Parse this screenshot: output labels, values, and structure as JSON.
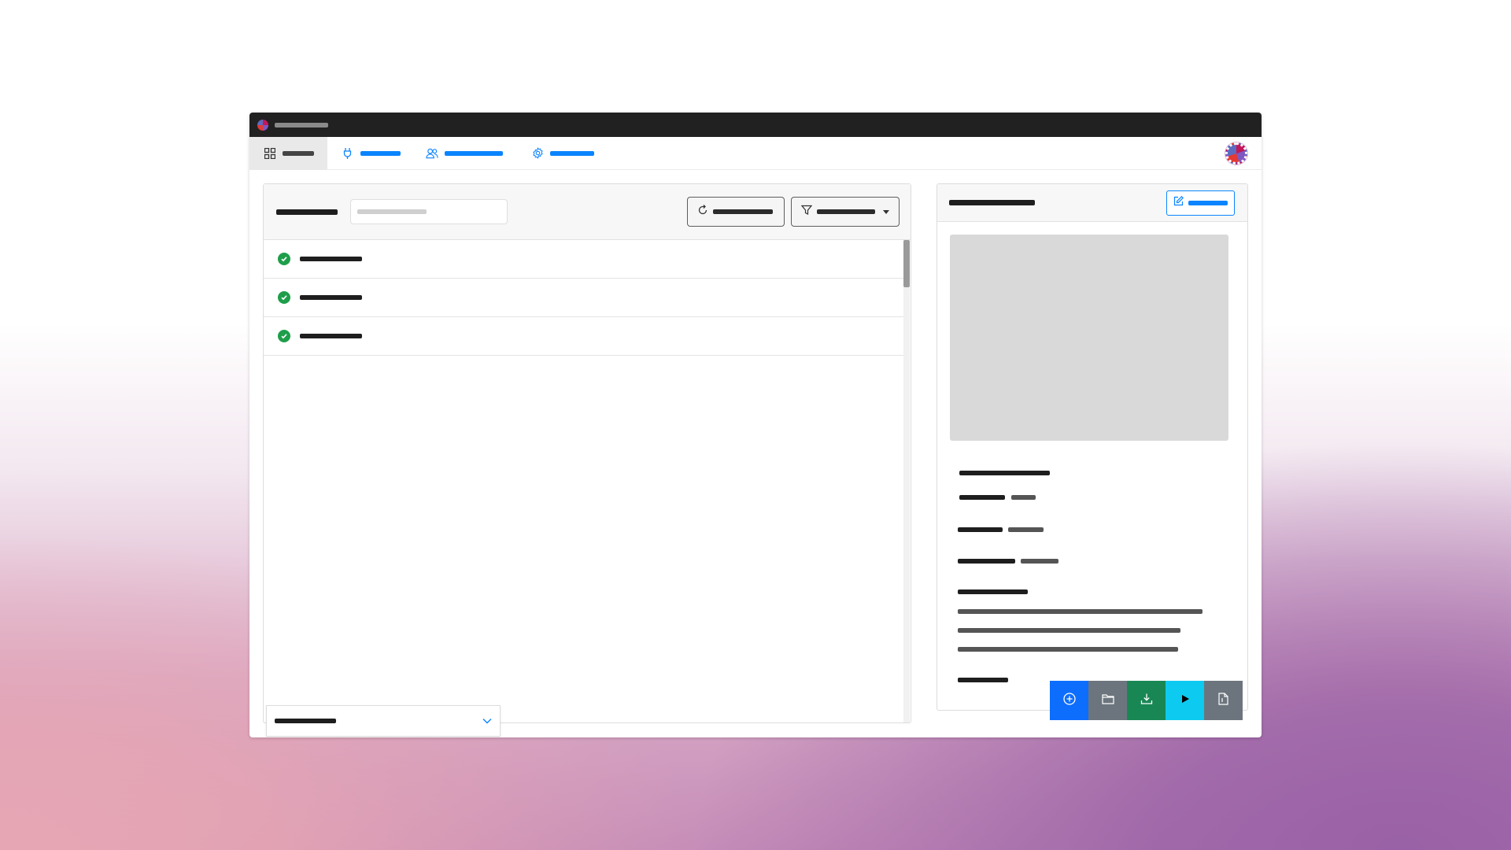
{
  "window": {
    "title": "",
    "logo": "app-logo"
  },
  "navbar": {
    "tabs": [
      {
        "label": "",
        "icon": "grid-icon",
        "active": true
      },
      {
        "label": "",
        "icon": "plug-icon",
        "active": false
      },
      {
        "label": "",
        "icon": "users-icon",
        "active": false
      },
      {
        "label": "",
        "icon": "gear-icon",
        "active": false
      }
    ],
    "avatar": "user-avatar"
  },
  "list_panel": {
    "title": "",
    "search": {
      "placeholder": "",
      "value": ""
    },
    "refresh_button": {
      "label": "",
      "icon": "refresh-icon"
    },
    "filter_button": {
      "label": "",
      "icon": "filter-icon"
    },
    "items": [
      {
        "label": "",
        "status": "success",
        "status_icon": "check-circle-icon"
      },
      {
        "label": "",
        "status": "success",
        "status_icon": "check-circle-icon"
      },
      {
        "label": "",
        "status": "success",
        "status_icon": "check-circle-icon"
      }
    ],
    "footer_select": {
      "value": "",
      "icon": "chevron-down-icon"
    }
  },
  "detail_panel": {
    "title": "",
    "edit_button": {
      "label": "",
      "icon": "edit-icon"
    },
    "image": "image-placeholder",
    "name": "",
    "fields": [
      {
        "label": "",
        "value": ""
      },
      {
        "label": "",
        "value": ""
      },
      {
        "label": "",
        "value": ""
      }
    ],
    "description_label": "",
    "description_lines": [
      "",
      "",
      ""
    ],
    "footer_label": ""
  },
  "action_bar": {
    "buttons": [
      {
        "name": "add-button",
        "icon": "plus-circle-icon",
        "color": "#0d6efd"
      },
      {
        "name": "open-folder-button",
        "icon": "folder-icon",
        "color": "#6c757d"
      },
      {
        "name": "download-button",
        "icon": "download-icon",
        "color": "#198754"
      },
      {
        "name": "run-button",
        "icon": "play-icon",
        "color": "#0dcaf0"
      },
      {
        "name": "document-button",
        "icon": "file-icon",
        "color": "#6c757d"
      }
    ]
  },
  "colors": {
    "accent": "#0a84ff",
    "success": "#1e9e4a",
    "titlebar": "#212121"
  }
}
